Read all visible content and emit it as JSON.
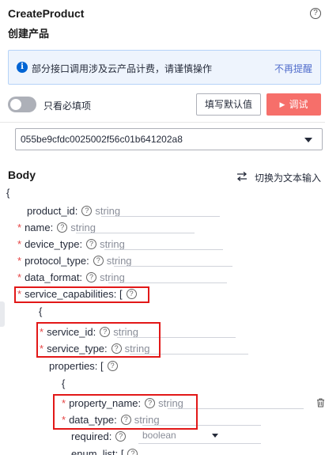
{
  "header": {
    "title": "CreateProduct",
    "subtitle": "创建产品",
    "help_icon": "question-circle-icon"
  },
  "notice": {
    "icon": "info-icon",
    "text": "部分接口调用涉及云产品计费，请谨慎操作",
    "dismiss": "不再提醒"
  },
  "controls": {
    "toggle_label": "只看必填项",
    "toggle_on": false,
    "fill_default": "填写默认值",
    "run": "调试"
  },
  "instance_select": {
    "value": "055be9cfdc0025002f56c01b641202a8"
  },
  "body_section": {
    "title": "Body",
    "switch_text": "切换为文本输入"
  },
  "code": {
    "open_brace": "{",
    "fields": {
      "product_id": {
        "key": "product_id:",
        "placeholder": "string"
      },
      "name": {
        "key": "name:",
        "placeholder": "string"
      },
      "device_type": {
        "key": "device_type:",
        "placeholder": "string"
      },
      "protocol_type": {
        "key": "protocol_type:",
        "placeholder": "string"
      },
      "data_format": {
        "key": "data_format:",
        "placeholder": "string"
      },
      "service_capabilities": {
        "key": "service_capabilities: ["
      },
      "service_id": {
        "key": "service_id:",
        "placeholder": "string"
      },
      "service_type": {
        "key": "service_type:",
        "placeholder": "string"
      },
      "properties": {
        "key": "properties: ["
      },
      "property_name": {
        "key": "property_name:",
        "placeholder": "string"
      },
      "data_type": {
        "key": "data_type:",
        "placeholder": "string"
      },
      "required": {
        "key": "required:",
        "value": "boolean"
      },
      "enum_list": {
        "key": "enum_list: ["
      }
    },
    "brace_open_1": "{",
    "brace_open_2": "{"
  },
  "colors": {
    "accent_red": "#f66f6a",
    "info_blue": "#0064d4",
    "link": "#526ecc",
    "highlight": "#e21818"
  }
}
